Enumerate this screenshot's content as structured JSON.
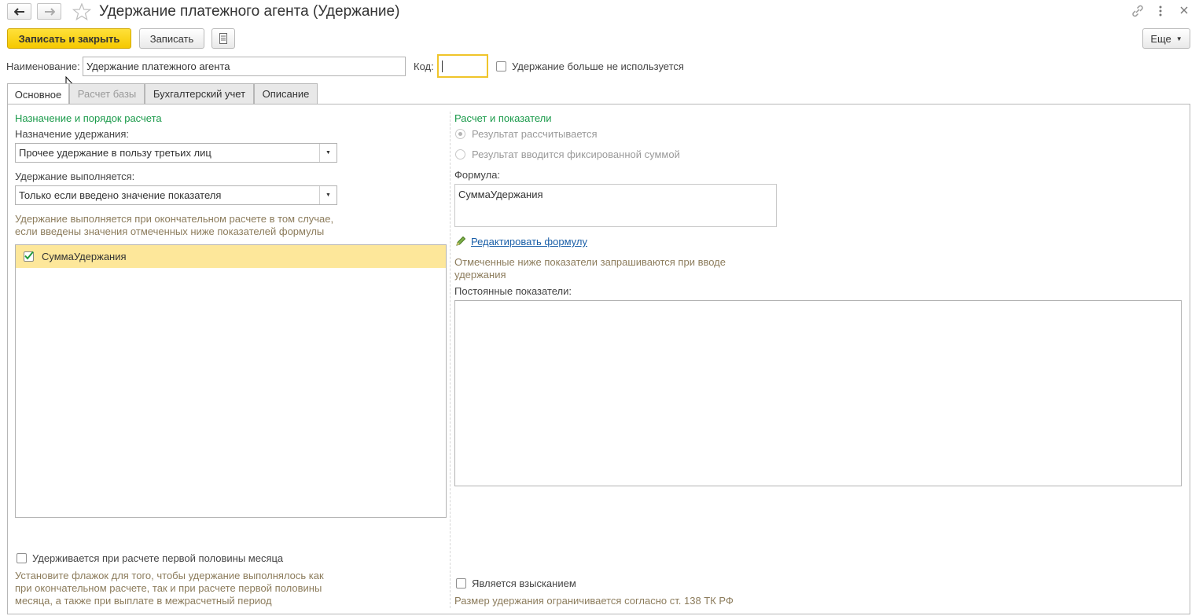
{
  "window": {
    "title": "Удержание платежного агента (Удержание)"
  },
  "toolbar": {
    "save_close_label": "Записать и закрыть",
    "save_label": "Записать",
    "more_label": "Еще"
  },
  "header": {
    "name_label": "Наименование:",
    "name_value": "Удержание платежного агента",
    "code_label": "Код:",
    "code_value": "",
    "unused_label": "Удержание больше не используется"
  },
  "tabs": [
    {
      "label": "Основное"
    },
    {
      "label": "Расчет базы"
    },
    {
      "label": "Бухгалтерский учет"
    },
    {
      "label": "Описание"
    }
  ],
  "left": {
    "section_title": "Назначение и порядок расчета",
    "purpose_label": "Назначение удержания:",
    "purpose_value": "Прочее удержание в пользу третьих лиц",
    "executed_label": "Удержание выполняется:",
    "executed_value": "Только если введено значение показателя",
    "executed_hint_1": "Удержание выполняется при окончательном расчете в том случае,",
    "executed_hint_2": "если введены значения отмеченных ниже показателей формулы",
    "indicators": [
      {
        "label": "СуммаУдержания",
        "checked": true
      }
    ],
    "first_half_label": "Удерживается при расчете первой половины месяца",
    "first_half_hint_1": "Установите флажок для того, чтобы удержание выполнялось как",
    "first_half_hint_2": "при окончательном расчете, так и при расчете первой половины",
    "first_half_hint_3": "месяца, а также при выплате в межрасчетный период"
  },
  "right": {
    "section_title": "Расчет и показатели",
    "radio_calculated": "Результат рассчитывается",
    "radio_fixed": "Результат вводится фиксированной суммой",
    "formula_label": "Формула:",
    "formula_value": "СуммаУдержания",
    "edit_formula_link": "Редактировать формулу",
    "requested_hint_1": "Отмеченные ниже показатели запрашиваются при вводе",
    "requested_hint_2": "удержания",
    "constant_label": "Постоянные показатели:",
    "recovery_label": "Является взысканием",
    "recovery_hint": "Размер удержания ограничивается согласно ст. 138 ТК РФ"
  },
  "colors": {
    "accent_yellow": "#f5c800",
    "selected_row": "#fde79a",
    "section_green": "#1a9a4a",
    "hint_brown": "#8c7c5c",
    "link_blue": "#1a5fa8"
  }
}
